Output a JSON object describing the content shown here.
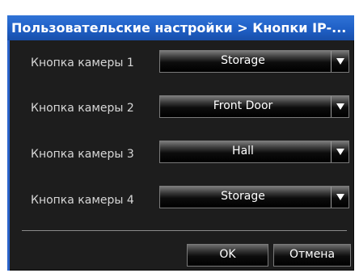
{
  "dialog": {
    "title": "Пользовательские настройки > Кнопки IP-...",
    "rows": [
      {
        "label": "Кнопка камеры 1",
        "value": "Storage"
      },
      {
        "label": "Кнопка камеры 2",
        "value": "Front Door"
      },
      {
        "label": "Кнопка камеры 3",
        "value": "Hall"
      },
      {
        "label": "Кнопка камеры 4",
        "value": "Storage"
      }
    ],
    "buttons": {
      "ok": "OK",
      "cancel": "Отмена"
    }
  },
  "icons": {
    "dropdown_arrow": "triangle-down-icon"
  },
  "colors": {
    "title_bar": "#1f5fc6",
    "dialog_bg": "#1d1d1d",
    "text": "#d7d7d7"
  }
}
